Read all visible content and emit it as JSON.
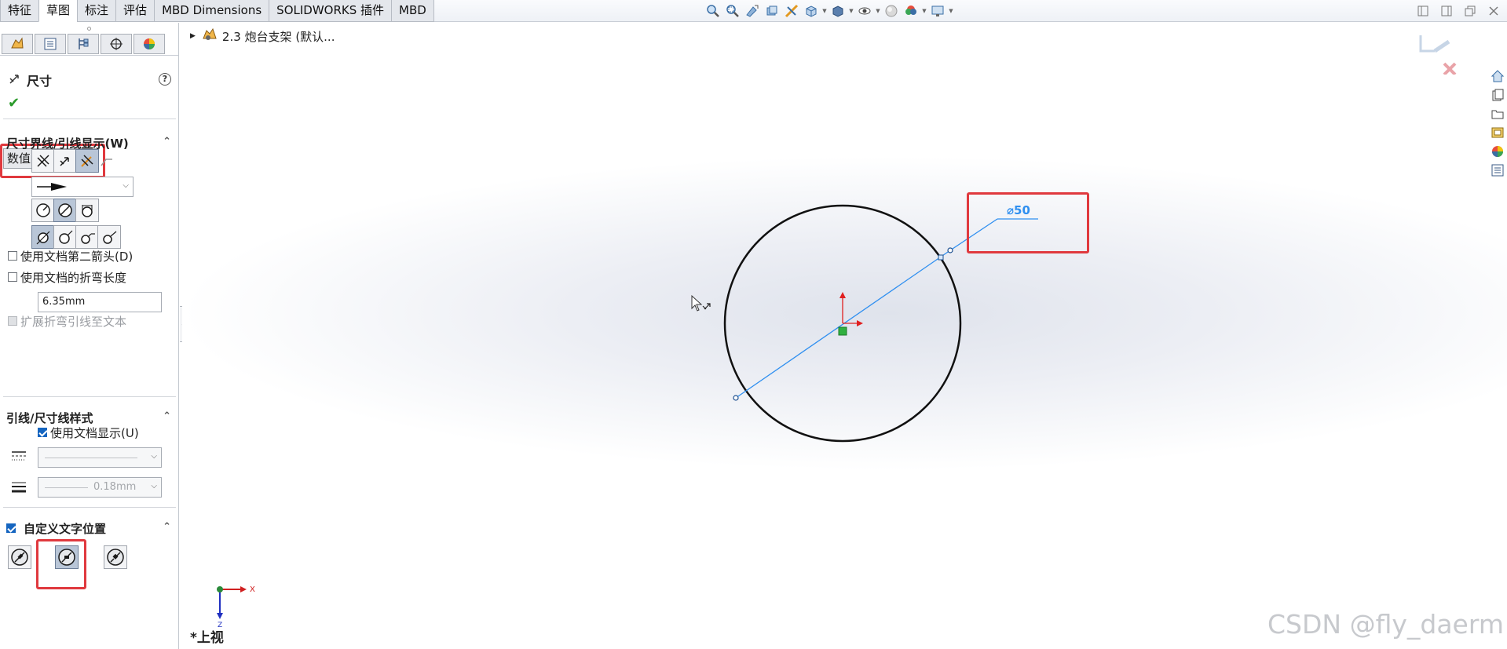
{
  "ribbon": {
    "tabs": [
      {
        "label": "特征"
      },
      {
        "label": "草图",
        "active": true
      },
      {
        "label": "标注"
      },
      {
        "label": "评估"
      },
      {
        "label": "MBD Dimensions"
      },
      {
        "label": "SOLIDWORKS 插件"
      },
      {
        "label": "MBD"
      }
    ]
  },
  "property_manager": {
    "title": "尺寸",
    "help": "?",
    "ok": "✔",
    "subtabs": [
      {
        "label": "数值"
      },
      {
        "label": "引线",
        "active": true
      },
      {
        "label": "其它"
      }
    ],
    "section_witness": {
      "title": "尺寸界线/引线显示(W)",
      "arrow_style_selected": "solid-arrow"
    },
    "use_doc_second_arrow": {
      "label": "使用文档第二箭头(D)",
      "checked": false
    },
    "use_doc_bend_length": {
      "label": "使用文档的折弯长度",
      "checked": false
    },
    "bend_length_value": "6.35mm",
    "extend_bent_leader": {
      "label": "扩展折弯引线至文本",
      "checked": true,
      "disabled": true
    },
    "section_leader_style": {
      "title": "引线/尺寸线样式",
      "use_doc_display": {
        "label": "使用文档显示(U)",
        "checked": true
      },
      "line_thickness_value": "0.18mm"
    },
    "section_custom_text": {
      "title": "自定义文字位置",
      "checked": true
    }
  },
  "graphics": {
    "tree_root": "2.3 炮台支架 (默认...",
    "dimension_text": "⌀50",
    "view_label": "*上视",
    "triad": {
      "x_label": "X",
      "z_label": "Z"
    },
    "watermark": "CSDN @fly_daerm"
  },
  "colors": {
    "highlight_red": "#e0393e",
    "dimension_blue": "#2f8ff0",
    "selection_blue": "#1565c0",
    "sketch_line": "#111111"
  }
}
